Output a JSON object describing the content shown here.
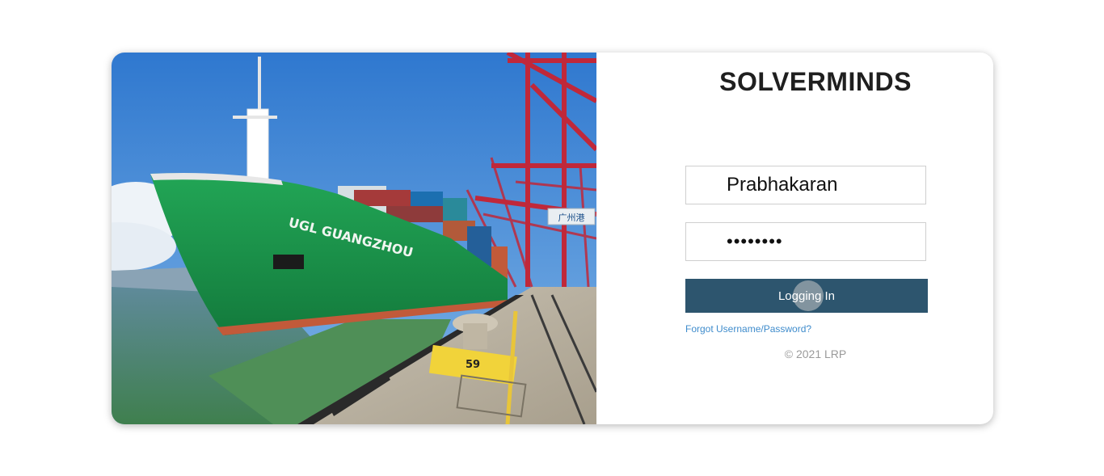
{
  "brand": {
    "title": "SOLVERMINDS"
  },
  "login": {
    "username_value": "Prabhakaran",
    "password_value": "••••••••",
    "submit_label": "Logging In",
    "forgot_link": "Forgot Username/Password?",
    "copyright": "© 2021 LRP"
  },
  "photo": {
    "ship_name": "UGL GUANGZHOU",
    "crane_sign": "广州港",
    "bollard_number": "59"
  },
  "colors": {
    "button": "#2d556e",
    "link": "#3f8ccc",
    "hull": "#1e9a4e",
    "crane": "#c0283a",
    "sky": "#3a86d6"
  }
}
